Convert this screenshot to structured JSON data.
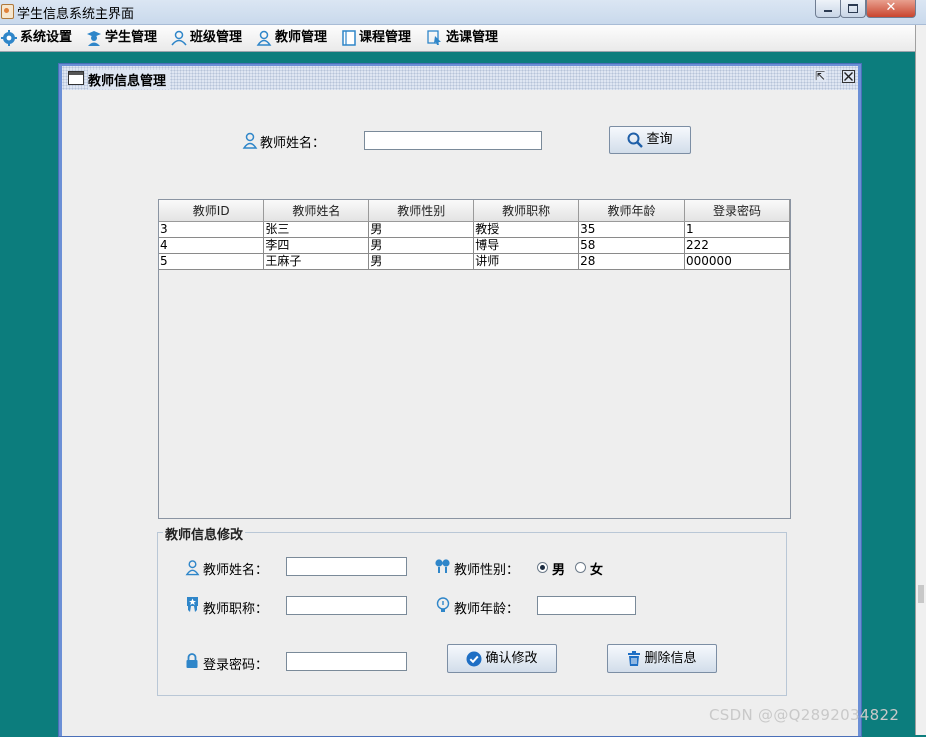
{
  "window": {
    "title": "学生信息系统主界面",
    "close_glyph": "✕"
  },
  "menubar": {
    "items": [
      {
        "label": "系统设置",
        "icon": "gear-icon"
      },
      {
        "label": "学生管理",
        "icon": "student-icon"
      },
      {
        "label": "班级管理",
        "icon": "class-icon"
      },
      {
        "label": "教师管理",
        "icon": "teacher-icon"
      },
      {
        "label": "课程管理",
        "icon": "book-icon"
      },
      {
        "label": "选课管理",
        "icon": "select-icon"
      }
    ]
  },
  "internal_frame": {
    "title": "教师信息管理",
    "restore_glyph": "⇱",
    "close_glyph": "⊠"
  },
  "search": {
    "label": "教师姓名：",
    "value": "",
    "button_label": "查询"
  },
  "table": {
    "columns": [
      "教师ID",
      "教师姓名",
      "教师性别",
      "教师职称",
      "教师年龄",
      "登录密码"
    ],
    "rows": [
      [
        "3",
        "张三",
        "男",
        "教授",
        "35",
        "1"
      ],
      [
        "4",
        "李四",
        "男",
        "博导",
        "58",
        "222"
      ],
      [
        "5",
        "王麻子",
        "男",
        "讲师",
        "28",
        "000000"
      ]
    ]
  },
  "edit_form": {
    "group_title": "教师信息修改",
    "name_label": "教师姓名：",
    "name_value": "",
    "gender_label": "教师性别：",
    "gender_options": [
      "男",
      "女"
    ],
    "gender_selected": "男",
    "title_label": "教师职称：",
    "title_value": "",
    "age_label": "教师年龄：",
    "age_value": "",
    "password_label": "登录密码：",
    "password_value": "",
    "confirm_button": "确认修改",
    "delete_button": "删除信息"
  },
  "watermark": "CSDN @@Q2892034822",
  "colors": {
    "desktop_teal": "#0c7d7d",
    "frame_blue": "#6b8fd6",
    "icon_blue": "#2f86c9"
  }
}
